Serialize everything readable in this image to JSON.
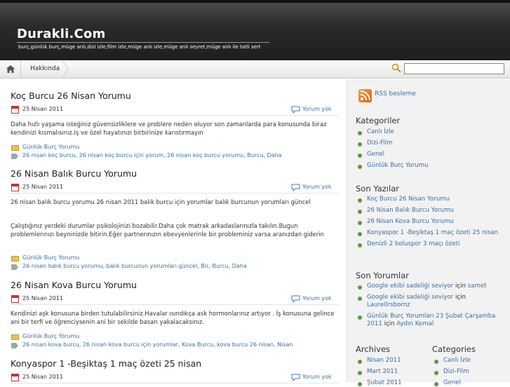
{
  "header": {
    "title": "Durakli.Com",
    "description": "burç,günlük burç,müge anlı,dizi izle,film izle,müge anlı izle,müge anlı seyret,müge anlı ile tatli sert"
  },
  "nav": {
    "about": "Hakkında",
    "search_placeholder": ""
  },
  "posts": [
    {
      "title": "Koç Burcu 26 Nisan Yorumu",
      "date": "25 Nisan 2011",
      "comments": "Yorum yok",
      "excerpt": [
        "Daha hızlı yaşama isteğiniz güvensizliklere ve problere neden oluyor son zamanlarda para konusunda biraz kendinizi kısmalısınız.Iş ve özel hayatınızı birbirinize karıstırmayın"
      ],
      "category": "Günlük Burç Yorumu",
      "tags": "26 nisan koç burcu, 26 nisan koç burcu için yorum, 26 nisan koç burcu yorumu, Burcu, Daha"
    },
    {
      "title": "26 Nisan Balık Burcu Yorumu",
      "date": "25 Nisan 2011",
      "comments": "Yorum yok",
      "excerpt": [
        "26 nisan balık burcu yorumu 26 nisan 2011 balık burcu için yorumlar balık burcunun yorumları güncel",
        "Çalıştığınız yerdeki durumlar psikolojinizi bozabilir.Daha çok matrak arkadaslarınızla takılın.Bugun problemlerınızı beyninizde bitirin.Eğer partnerınızın ebevyenlerinle bir probleminiz varsa aranızdan giderin"
      ],
      "category": "Günlük Burç Yorumu",
      "tags": "26 nisan balık burcu yorumu, balık burcunun yorumları güncel, Bir, Burcu, Daha"
    },
    {
      "title": "26 Nisan Kova Burcu Yorumu",
      "date": "25 Nisan 2011",
      "comments": "Yorum yok",
      "excerpt": [
        "Kendinizi aşk konusuna birden tutulabilirsiniz.Havalar ısındıkça ask hormonlarınız artıyor . İş konusuna gelince ani bir terfi ve öğrenciysenin ani bir sekilde basarı yakalacaksınız."
      ],
      "category": "Günlük Burç Yorumu",
      "tags": "26 nisan kova burcu, 26 nisan kova burcu için yorumlar, Kova Burcu, kova burcu 26 nisan, Nisan"
    },
    {
      "title": "Konyaspor 1 -Beşiktaş 1 maç özeti 25 nisan",
      "date": "25 Nisan 2011",
      "comments": "Yorum yok"
    }
  ],
  "sidebar": {
    "rss": "RSS besleme",
    "categories_title": "Kategoriler",
    "categories": [
      "Canlı İzle",
      "Dizi-Film",
      "Genel",
      "Günlük Burç Yorumu"
    ],
    "recent_title": "Son Yazılar",
    "recent": [
      "Koç Burcu 26 Nisan Yorumu",
      "26 Nisan Balık Burcu Yorumu",
      "26 Nisan Kova Burcu Yorumu",
      "Konyaspor 1 -Beşiktaş 1 maç özeti 25 nisan",
      "Denizli 2 boluspor 3 maçı özeti"
    ],
    "comments_title": "Son Yorumlar",
    "comments": [
      {
        "link": "Google ekibi sadeliği seviyor",
        "sep": " için ",
        "author": "samet"
      },
      {
        "link": "Google ekibi sadeliği seviyor",
        "sep": " için ",
        "author": "Laure0rsbornz"
      },
      {
        "link": "Günlük Burç Yorumları 23 Şubat Çarşamba 2011",
        "sep": " için ",
        "author": "Aydın Kemal"
      }
    ],
    "archives_title": "Archives",
    "archives": [
      "Nisan 2011",
      "Mart 2011",
      "Şubat 2011"
    ],
    "categories2_title": "Categories",
    "categories2": [
      "Canlı İzle",
      "Dizi-Film",
      "Genel"
    ]
  }
}
